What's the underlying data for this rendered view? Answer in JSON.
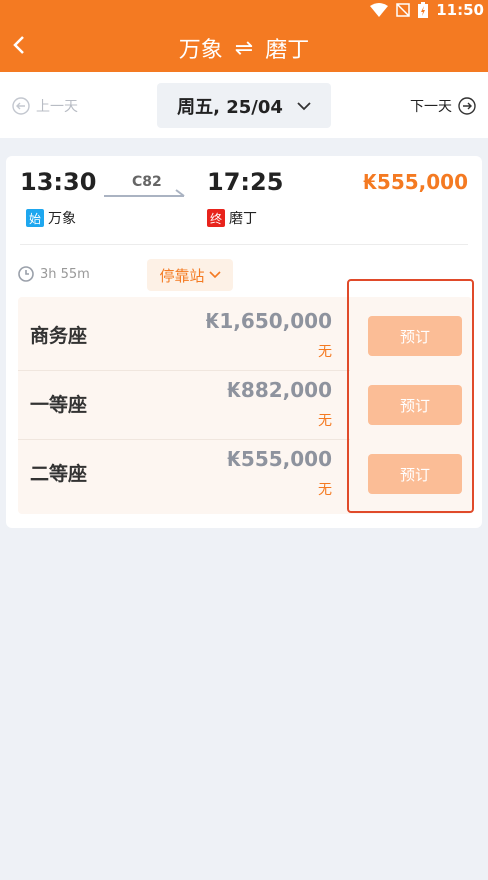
{
  "status_bar": {
    "time": "11:50"
  },
  "header": {
    "from": "万象",
    "to": "磨丁",
    "swap_symbol": "⇌"
  },
  "date_bar": {
    "prev_label": "上一天",
    "date": "周五, 25/04",
    "next_label": "下一天"
  },
  "train": {
    "dep_time": "13:30",
    "arr_time": "17:25",
    "number": "C82",
    "dep_tag": "始",
    "dep_station": "万象",
    "arr_tag": "终",
    "arr_station": "磨丁",
    "lowest_price": "₭555,000",
    "duration": "3h 55m",
    "stops_label": "停靠站"
  },
  "seats": [
    {
      "name": "商务座",
      "price": "₭1,650,000",
      "availability": "无",
      "book_label": "预订"
    },
    {
      "name": "一等座",
      "price": "₭882,000",
      "availability": "无",
      "book_label": "预订"
    },
    {
      "name": "二等座",
      "price": "₭555,000",
      "availability": "无",
      "book_label": "预订"
    }
  ],
  "colors": {
    "brand": "#f47a22",
    "book_disabled": "#fbbd96",
    "highlight": "#e04a2a"
  }
}
